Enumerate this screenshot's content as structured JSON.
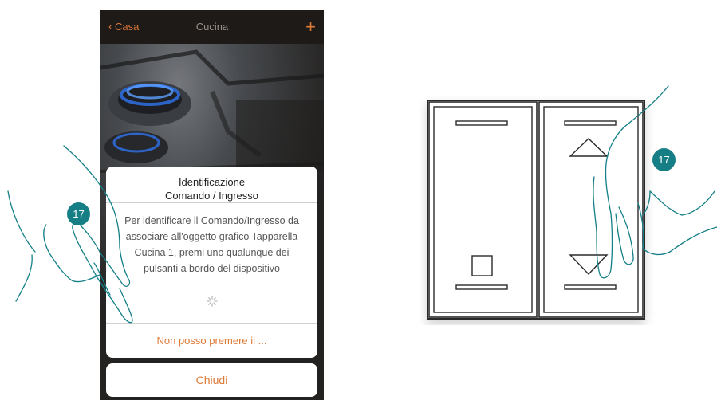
{
  "navbar": {
    "back_label": "Casa",
    "title": "Cucina",
    "add_label": "+"
  },
  "dialog": {
    "title_line1": "Identificazione",
    "title_line2": "Comando / Ingresso",
    "message_lines": [
      "Per identificare il Comando/Ingresso da",
      "associare all'oggetto grafico Tapparella",
      "Cucina 1, premi uno qualunque dei",
      "pulsanti a bordo del dispositivo"
    ],
    "action_label": "Non posso premere il ...",
    "close_label": "Chiudi"
  },
  "step_badges": {
    "left": "17",
    "right": "17"
  },
  "colors": {
    "accent": "#e07a37",
    "badge": "#167f86",
    "navbar": "#1e1a17"
  }
}
